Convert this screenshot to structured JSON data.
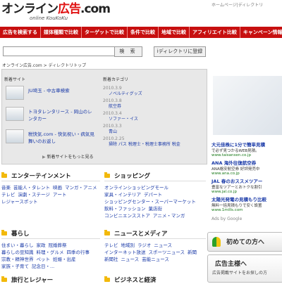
{
  "header": {
    "logo_main": "オンライン",
    "logo_red": "広告",
    "logo_suffix": ".com",
    "logo_sub": "online KouKoKu",
    "top_link": "ホームページ|ディレクトリ"
  },
  "nav": [
    "広告を検索する",
    "媒体種類で比較",
    "ターゲットで比較",
    "条件で比較",
    "地域で比較",
    "アフィリエイト比較",
    "キャンペーン情報"
  ],
  "search": {
    "button": "検 索",
    "register": "iディレクトリに登録",
    "value": ""
  },
  "breadcrumb": "オンライン広告.com > ディレクトリトップ",
  "panel": {
    "new_sites_title": "新着サイト",
    "new_categories_title": "新着カテゴリ",
    "sites": [
      {
        "title": "JU埼玉 - 中古車検索"
      },
      {
        "title": "トヨタレンタリース - 岡山のレンタカー"
      },
      {
        "title": "税快気.com - 快気祝い・病気見舞いのお返し"
      }
    ],
    "more": "新着サイトをもっと見る",
    "categories": [
      {
        "date": "2010.3.9",
        "name": "ノベルティグッズ"
      },
      {
        "date": "2010.3.8",
        "name": "航空券"
      },
      {
        "date": "2010.3.4",
        "name": "ソファー・イス"
      },
      {
        "date": "2010.3.3",
        "name": "青山"
      },
      {
        "date": "2010.2.25",
        "name": "掃除 パス 税理士・税理士事務所 税金"
      }
    ]
  },
  "sections": {
    "entertainment": {
      "title": "エンターテインメント",
      "links": [
        "音楽",
        "芸能人・タレント",
        "映画",
        "マンガ・アニメ",
        "テレビ",
        "演劇・ステージ",
        "アート",
        "レジャースポット"
      ]
    },
    "shopping": {
      "title": "ショッピング",
      "links": [
        "オンラインショッピングモール",
        "家具・インテリア",
        "デパート",
        "ショッピングセンター・スーパーマーケット",
        "飲料・ファッション",
        "菓店街",
        "コンビニエンスストア",
        "アニメ・マンガ"
      ]
    },
    "living": {
      "title": "暮らし",
      "links": [
        "住まい・暮らし",
        "家政",
        "冠婚葬祭",
        "暮らしの豆知識",
        "料理・グルメ",
        "四季の行事",
        "宗教・精神世界",
        "ペット",
        "妊娠・出産",
        "家族・子育て",
        "記念日・..."
      ]
    },
    "news": {
      "title": "ニュースとメディア",
      "links": [
        "テレビ",
        "地域別",
        "ラジオ",
        "ニュース",
        "インターネット放送",
        "スポーツニュース",
        "新聞",
        "新聞社",
        "ニュース",
        "芸能ニュース"
      ]
    },
    "travel": {
      "title": "旅行とレジャー"
    },
    "business": {
      "title": "ビジネスと経済"
    }
  },
  "right": {
    "ads": [
      {
        "h": "大元佳株に1分で簡単見積",
        "b": "で必ず見つかるWEB見積。",
        "u": "www.taisansen.co.jp"
      },
      {
        "h": "ANA 海外往復航空券",
        "b": "ANA格安航空券 好評発売中",
        "u": "www.ana.co.jp"
      },
      {
        "h": "JAL 春のおススメツアー",
        "b": "豊富なツアーとおトクな割引",
        "u": "www.jal.co.jp"
      },
      {
        "h": "太陽光発電の見積もり比較",
        "b": "無料一括見積もりで安く設置",
        "u": "www.1mills.com"
      }
    ],
    "ads_by": "Ads by Google",
    "first_time": "初めての方へ",
    "listing_title": "広告主様へ",
    "listing_sub": "広告掲載サイトをお探しの方"
  }
}
